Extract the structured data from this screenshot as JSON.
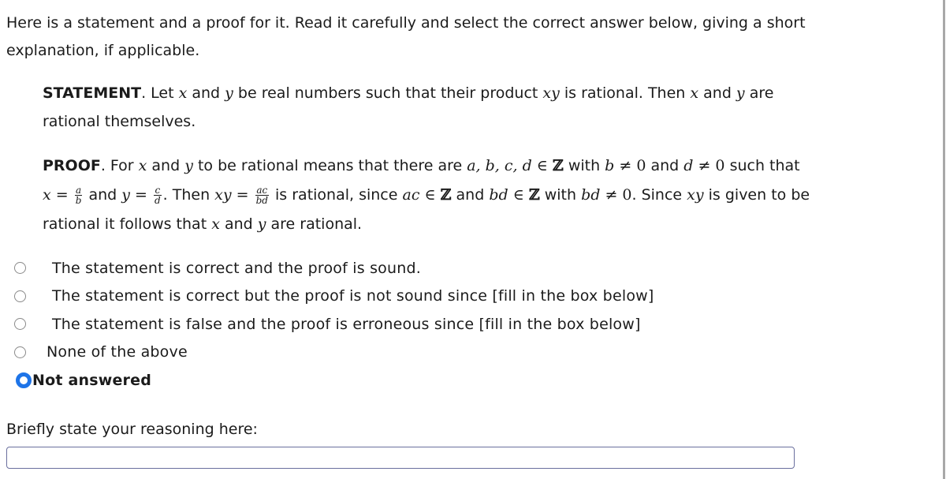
{
  "intro": {
    "line1": "Here is a statement and a proof for it. Read it carefully and select the correct answer below, giving a short",
    "line2": "explanation, if applicable."
  },
  "statement": {
    "label": "STATEMENT",
    "t1": ". Let ",
    "x": "x",
    "t2": " and ",
    "y": "y",
    "t3": " be real numbers such that their product ",
    "xy": "xy",
    "t4": " is rational. Then ",
    "t5": " are",
    "t6": "rational themselves."
  },
  "proof": {
    "label": "PROOF",
    "t1": ". For ",
    "x": "x",
    "and": " and ",
    "y": "y",
    "t2": " to be rational means that there are ",
    "vars": "a, b, c, d",
    "in": " ∈ ",
    "Z": "ℤ",
    "with": " with ",
    "b": "b",
    "neq0": " ≠ 0",
    "d": "d",
    "t3": " such that",
    "eq": " = ",
    "a": "a",
    "c": "c",
    "then": ". Then ",
    "xy": "xy",
    "ac": "ac",
    "bd": "bd",
    "t4": " is rational, since ",
    "t5": ". Since ",
    "t6": " is given to be",
    "t7": "rational it follows that ",
    "t8": " are rational."
  },
  "options": [
    {
      "label": "The statement is correct and the proof is sound.",
      "selected": false
    },
    {
      "label": "The statement is correct but the proof is not sound since [fill in the box below]",
      "selected": false
    },
    {
      "label": "The statement is false and the proof is erroneous since [fill in the box below]",
      "selected": false
    },
    {
      "label": "None of the above",
      "selected": false
    },
    {
      "label": "Not answered",
      "selected": true
    }
  ],
  "reasoning": {
    "label": "Briefly state your reasoning here:",
    "value": ""
  },
  "colors": {
    "selected_radio": "#1e74e8",
    "input_border": "#6a6f9e"
  }
}
